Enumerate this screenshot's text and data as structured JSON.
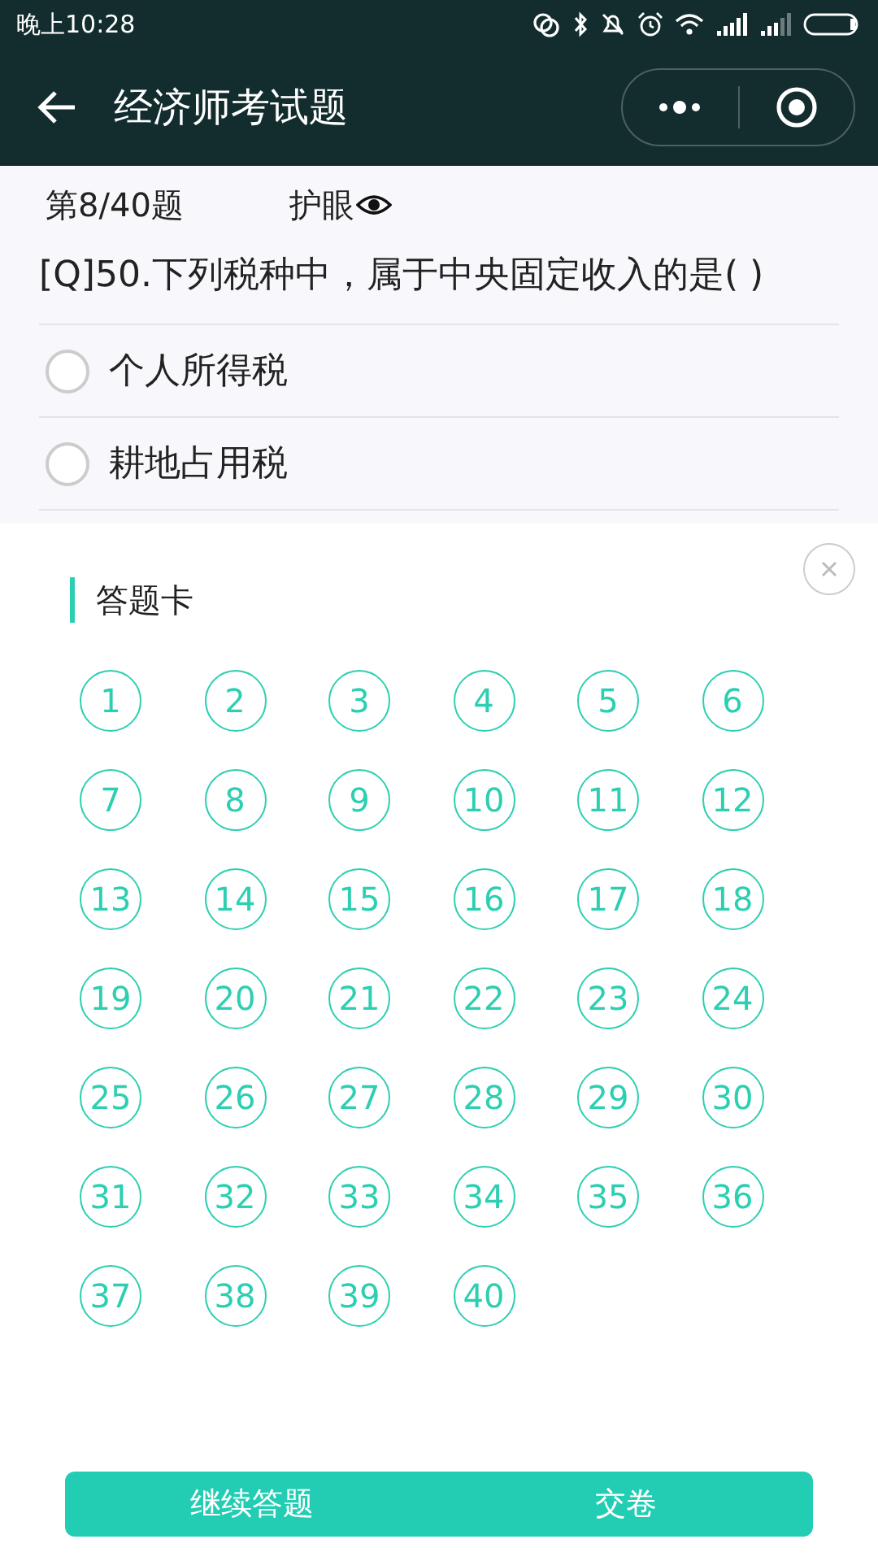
{
  "status_bar": {
    "time": "晚上10:28"
  },
  "nav": {
    "title": "经济师考试题"
  },
  "progress": {
    "counter": "第8/40题",
    "eye_mode": "护眼"
  },
  "question": {
    "text": "[Q]50.下列税种中，属于中央固定收入的是( )",
    "options": [
      {
        "label": "个人所得税",
        "selected": false
      },
      {
        "label": "耕地占用税",
        "selected": false
      }
    ]
  },
  "answer_card": {
    "title": "答题卡",
    "numbers": [
      "1",
      "2",
      "3",
      "4",
      "5",
      "6",
      "7",
      "8",
      "9",
      "10",
      "11",
      "12",
      "13",
      "14",
      "15",
      "16",
      "17",
      "18",
      "19",
      "20",
      "21",
      "22",
      "23",
      "24",
      "25",
      "26",
      "27",
      "28",
      "29",
      "30",
      "31",
      "32",
      "33",
      "34",
      "35",
      "36",
      "37",
      "38",
      "39",
      "40"
    ]
  },
  "buttons": [
    "继续答题",
    "交卷"
  ]
}
